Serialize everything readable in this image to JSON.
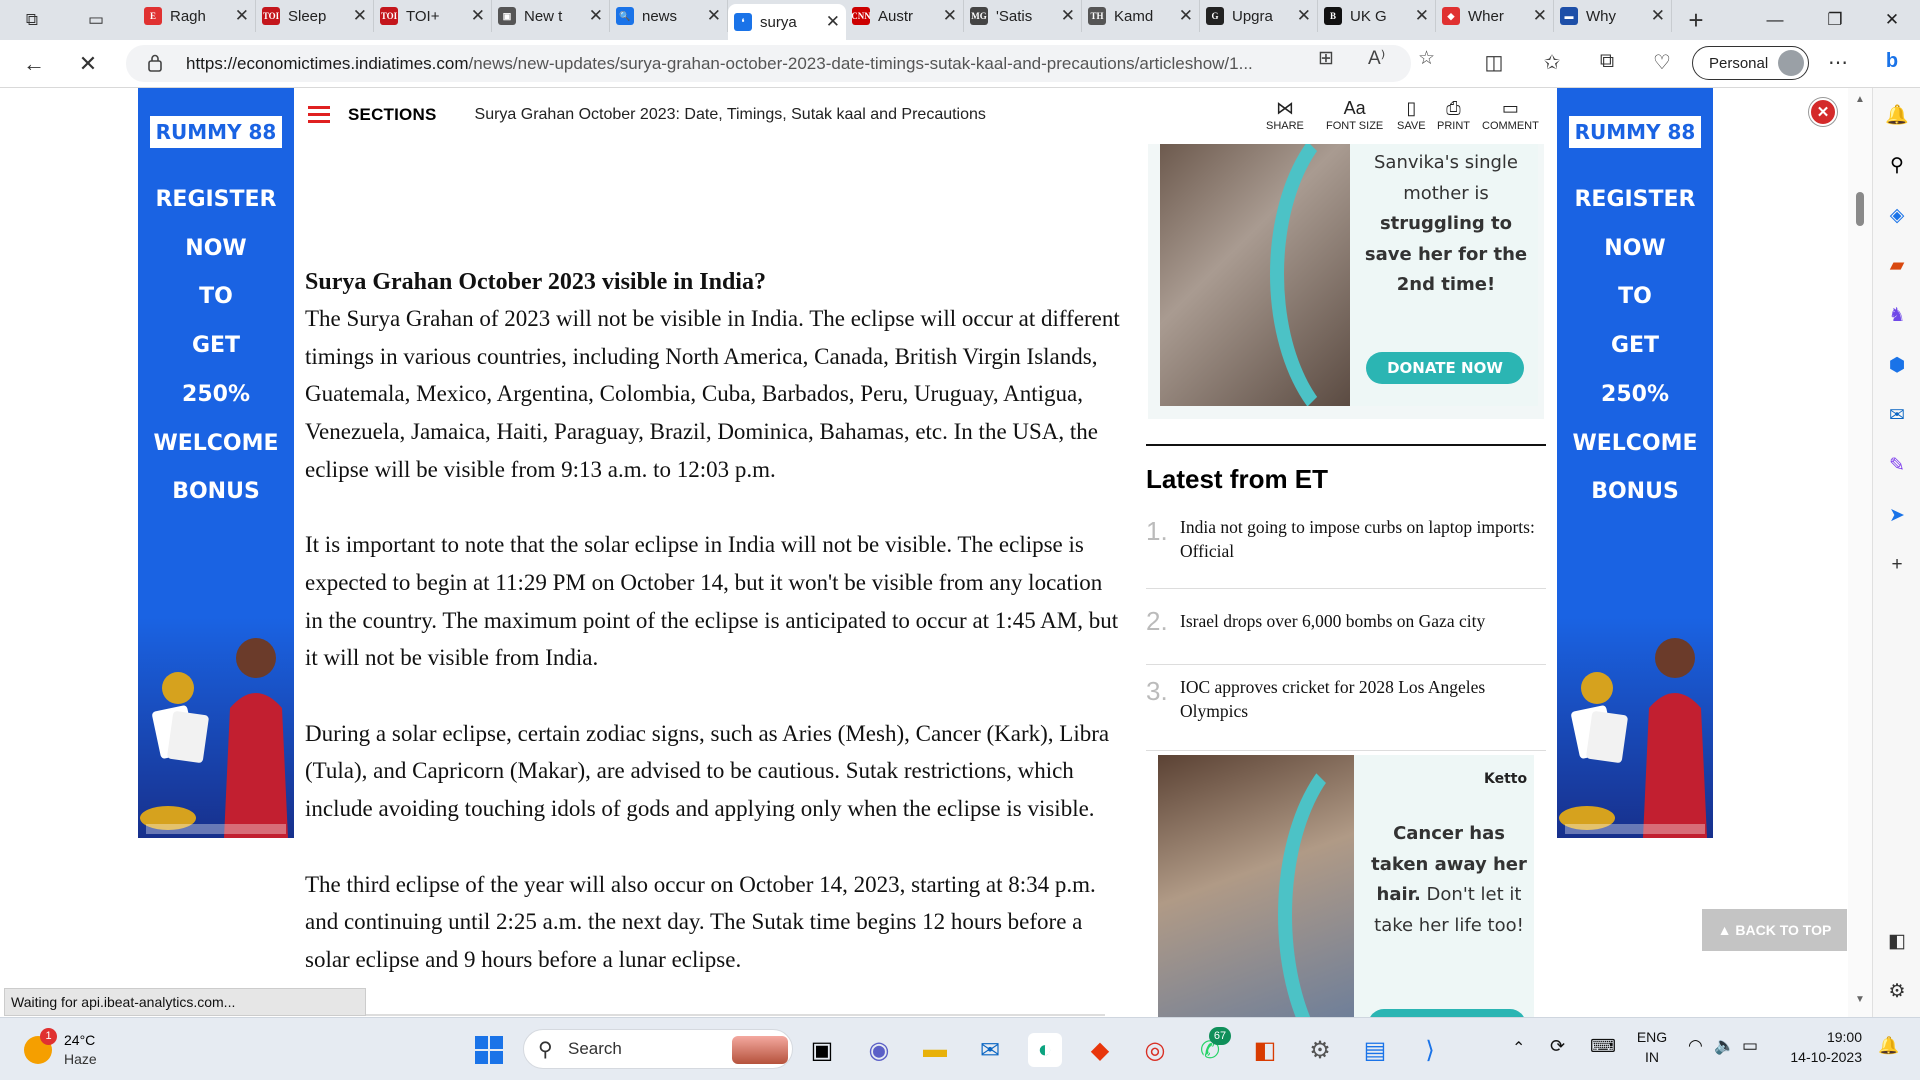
{
  "browser": {
    "tabs": [
      {
        "label": "Ragh",
        "fav": "E",
        "favColor": "#e03131"
      },
      {
        "label": "Sleep",
        "fav": "TOI",
        "favColor": "#c4161c"
      },
      {
        "label": "TOI+",
        "fav": "TOI",
        "favColor": "#c4161c"
      },
      {
        "label": "New t",
        "fav": "▣",
        "favColor": "#555555"
      },
      {
        "label": "news",
        "fav": "🔍",
        "favColor": "#1a73e8"
      },
      {
        "label": "surya",
        "fav": "❛",
        "favColor": "#1a73e8"
      },
      {
        "label": "Austr",
        "fav": "CNN",
        "favColor": "#cc0000"
      },
      {
        "label": "'Satis",
        "fav": "MG",
        "favColor": "#444444"
      },
      {
        "label": "Kamd",
        "fav": "TH",
        "favColor": "#555555"
      },
      {
        "label": "Upgra",
        "fav": "G",
        "favColor": "#222222"
      },
      {
        "label": "UK G",
        "fav": "B",
        "favColor": "#111111"
      },
      {
        "label": "Wher",
        "fav": "◆",
        "favColor": "#e03131"
      },
      {
        "label": "Why",
        "fav": "▬",
        "favColor": "#1d4fa8"
      }
    ],
    "active_tab": 5,
    "url_domain": "https://economictimes.indiatimes.com",
    "url_path": "/news/new-updates/surya-grahan-october-2023-date-timings-sutak-kaal-and-precautions/articleshow/1...",
    "profile": "Personal",
    "status": "Waiting for api.ibeat-analytics.com..."
  },
  "header": {
    "sections": "SECTIONS",
    "title": "Surya Grahan October 2023: Date, Timings, Sutak kaal and Precautions",
    "tools": [
      "SHARE",
      "FONT SIZE",
      "SAVE",
      "PRINT",
      "COMMENT"
    ]
  },
  "ads": {
    "brand": "RUMMY 88",
    "lines": [
      "REGISTER",
      "NOW",
      "TO",
      "GET",
      "250%",
      "WELCOME",
      "BONUS"
    ]
  },
  "article": {
    "heading": "Surya Grahan October 2023 visible in India?",
    "paragraphs": [
      "The Surya Grahan of 2023 will not be visible in India. The eclipse will occur at different timings in various countries, including North America, Canada, British Virgin Islands, Guatemala, Mexico, Argentina, Colombia, Cuba, Barbados, Peru, Uruguay, Antigua, Venezuela, Jamaica, Haiti, Paraguay, Brazil, Dominica, Bahamas, etc. In the USA, the eclipse will be visible from 9:13 a.m. to 12:03 p.m.",
      "It is important to note that the solar eclipse in India will not be visible. The eclipse is expected to begin at 11:29 PM on October 14, but it won't be visible from any location in the country. The maximum point of the eclipse is anticipated to occur at 1:45 AM, but it will not be visible from India.",
      "During a solar eclipse, certain zodiac signs, such as Aries (Mesh), Cancer (Kark), Libra (Tula), and Capricorn (Makar), are advised to be cautious. Sutak restrictions, which include avoiding touching idols of gods and applying only when the eclipse is visible.",
      "The third eclipse of the year will also occur on October 14, 2023, starting at 8:34 p.m. and continuing until 2:25 a.m. the next day. The Sutak time begins 12 hours before a solar eclipse and 9 hours before a lunar eclipse."
    ]
  },
  "rail": {
    "ad1": {
      "text1": "Sanvika's single mother is",
      "text2": "struggling to save her for the 2nd time!",
      "button": "DONATE NOW"
    },
    "latest_title": "Latest from ET",
    "latest": [
      {
        "num": "1.",
        "text": "India not going to impose curbs on laptop imports: Official"
      },
      {
        "num": "2.",
        "text": "Israel drops over 6,000 bombs on Gaza city"
      },
      {
        "num": "3.",
        "text": "IOC approves cricket for 2028 Los Angeles Olympics"
      }
    ],
    "ad2": {
      "logo": "Ketto",
      "text1": "Cancer has taken away her hair.",
      "text2": "Don't let it take her life too!"
    }
  },
  "back_to_top": "▲ BACK TO TOP",
  "taskbar": {
    "weather_temp": "24°C",
    "weather_desc": "Haze",
    "weather_badge": "1",
    "search": "Search",
    "whatsapp_badge": "67",
    "lang1": "ENG",
    "lang2": "IN",
    "time": "19:00",
    "date": "14-10-2023"
  }
}
